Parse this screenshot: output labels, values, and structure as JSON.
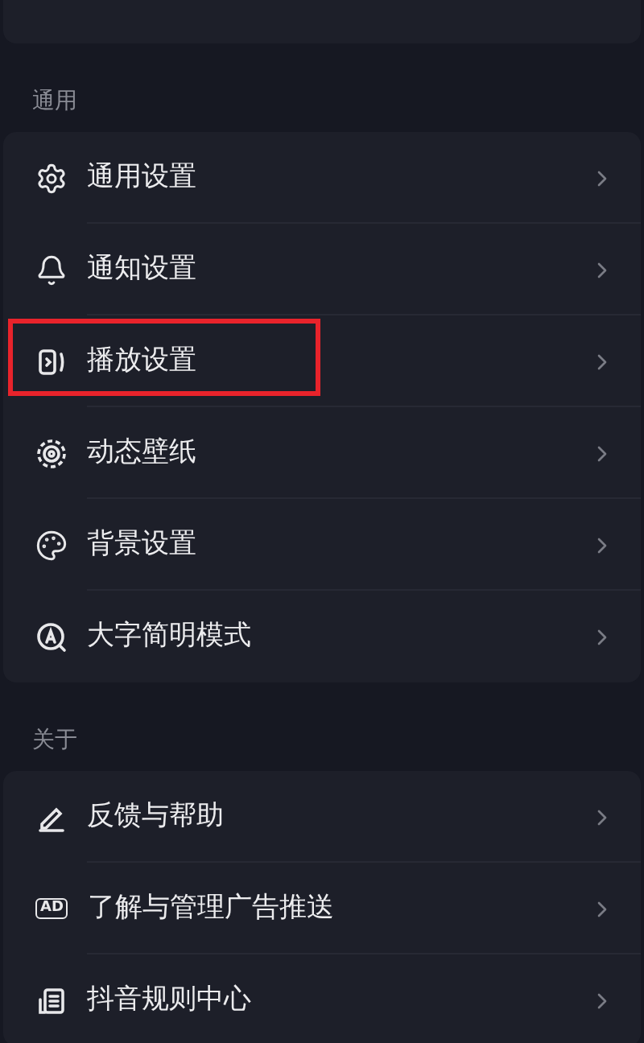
{
  "sections": [
    {
      "header": "通用",
      "items": [
        {
          "label": "通用设置",
          "highlighted": false
        },
        {
          "label": "通知设置",
          "highlighted": false
        },
        {
          "label": "播放设置",
          "highlighted": true
        },
        {
          "label": "动态壁纸",
          "highlighted": false
        },
        {
          "label": "背景设置",
          "highlighted": false
        },
        {
          "label": "大字简明模式",
          "highlighted": false
        }
      ]
    },
    {
      "header": "关于",
      "items": [
        {
          "label": "反馈与帮助",
          "highlighted": false
        },
        {
          "icon_text": "AD",
          "label": "了解与管理广告推送",
          "highlighted": false
        },
        {
          "label": "抖音规则中心",
          "highlighted": false
        }
      ]
    }
  ]
}
